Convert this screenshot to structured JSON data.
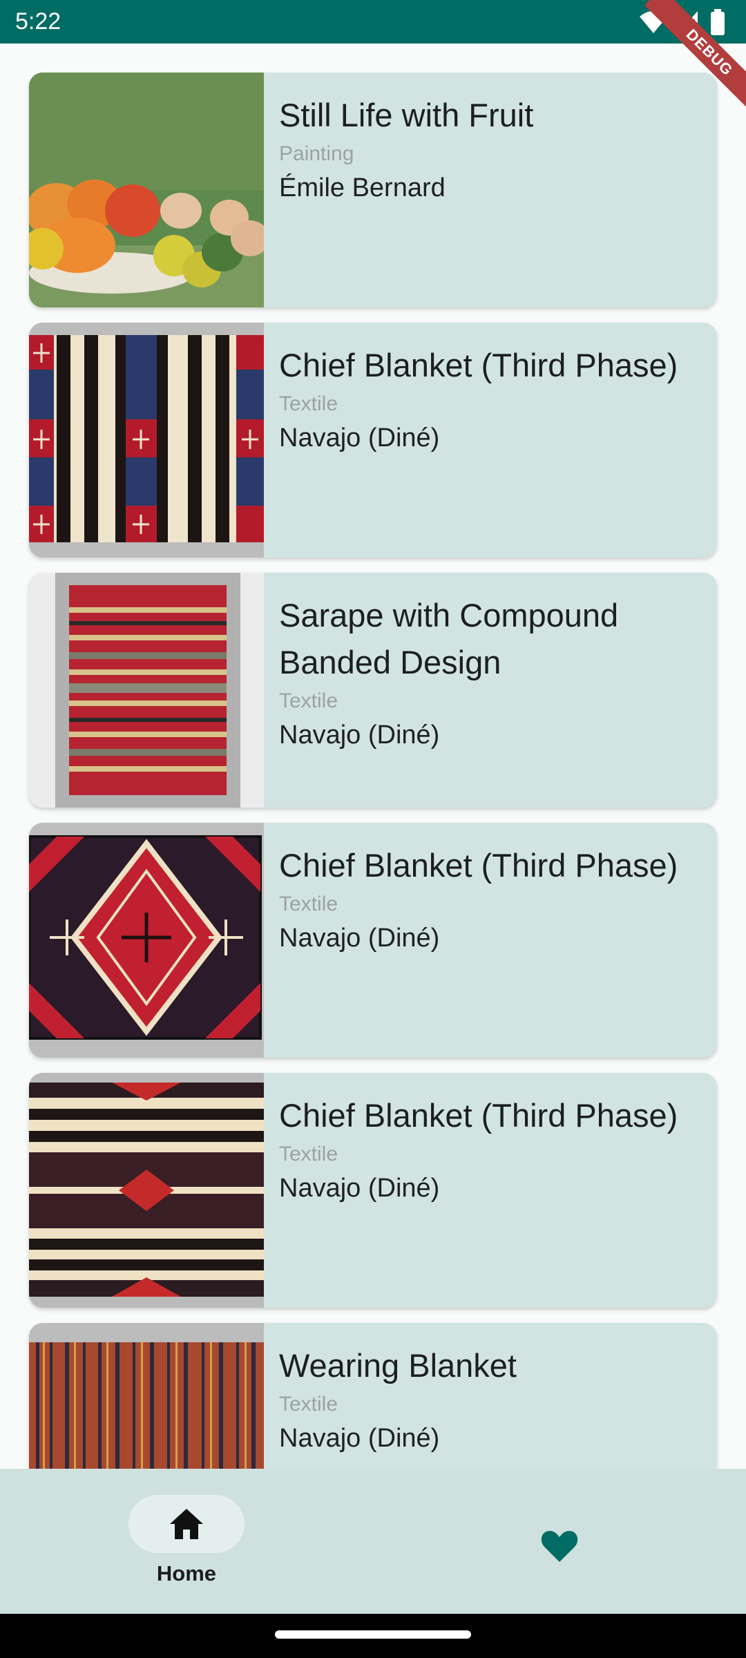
{
  "status_bar": {
    "time": "5:22",
    "debug_label": "DEBUG"
  },
  "artworks": [
    {
      "title": "Still Life with Fruit",
      "category": "Painting",
      "artist": "Émile Bernard",
      "image": "still-life-fruit-painting"
    },
    {
      "title": "Chief Blanket (Third Phase)",
      "category": "Textile",
      "artist": "Navajo (Diné)",
      "image": "striped-blanket-red-crosses"
    },
    {
      "title": "Sarape with Compound Banded Design",
      "category": "Textile",
      "artist": "Navajo (Diné)",
      "image": "red-banded-sarape"
    },
    {
      "title": "Chief Blanket (Third Phase)",
      "category": "Textile",
      "artist": "Navajo (Diné)",
      "image": "red-diamond-blanket"
    },
    {
      "title": "Chief Blanket (Third Phase)",
      "category": "Textile",
      "artist": "Navajo (Diné)",
      "image": "horizontal-striped-blanket"
    },
    {
      "title": "Wearing Blanket",
      "category": "Textile",
      "artist": "Navajo (Diné)",
      "image": "vertical-striped-blanket"
    }
  ],
  "bottom_nav": {
    "home_label": "Home",
    "home_icon": "home-icon",
    "favorites_icon": "heart-icon",
    "accent": "#006c63"
  }
}
